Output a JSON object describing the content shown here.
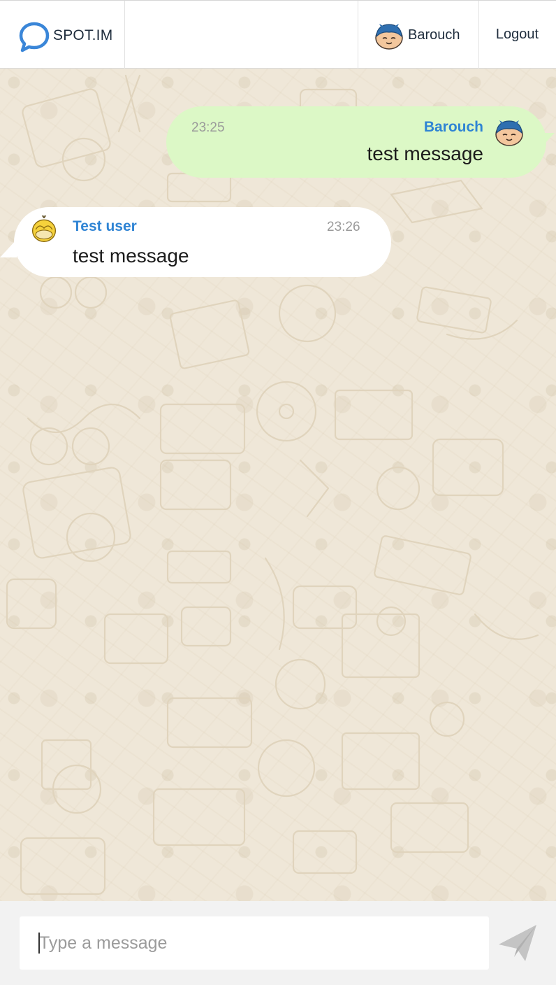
{
  "header": {
    "logo_text": "SPOT.IM",
    "user_name": "Barouch",
    "logout_label": "Logout"
  },
  "messages": [
    {
      "direction": "outgoing",
      "author": "Barouch",
      "time": "23:25",
      "text": "test message",
      "avatar": "blue-haired-character-avatar"
    },
    {
      "direction": "incoming",
      "author": "Test user",
      "time": "23:26",
      "text": "test message",
      "avatar": "yellow-duck-avatar"
    }
  ],
  "composer": {
    "placeholder": "Type a message",
    "send_icon": "paper-plane-icon"
  },
  "colors": {
    "brand_blue": "#3a86d8",
    "author_blue": "#2f84d4",
    "outgoing_bubble": "#dcf8c6",
    "incoming_bubble": "#ffffff",
    "chat_background": "#efe7d8"
  }
}
